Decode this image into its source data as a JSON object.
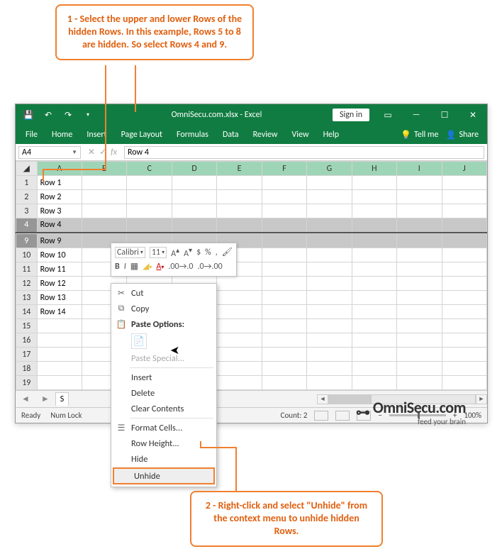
{
  "callouts": {
    "top": "1 - Select the upper and lower Rows of the hidden Rows. In this example, Rows 5 to 8 are hidden. So select Rows 4 and 9.",
    "bottom": "2 - Right-click and select \"Unhide\" from the context menu to unhide hidden Rows."
  },
  "titlebar": {
    "title": "OmniSecu.com.xlsx - Excel",
    "signin": "Sign in"
  },
  "ribbon": {
    "tabs": [
      "File",
      "Home",
      "Insert",
      "Page Layout",
      "Formulas",
      "Data",
      "Review",
      "View",
      "Help"
    ],
    "tellme": "Tell me",
    "share": "Share"
  },
  "namebox": "A4",
  "formula_value": "Row 4",
  "columns": [
    "A",
    "B",
    "C",
    "D",
    "E",
    "F",
    "G",
    "H",
    "I",
    "J"
  ],
  "rows": [
    {
      "num": "1",
      "val": "Row 1",
      "sel": false
    },
    {
      "num": "2",
      "val": "Row 2",
      "sel": false
    },
    {
      "num": "3",
      "val": "Row 3",
      "sel": false
    },
    {
      "num": "4",
      "val": "Row 4",
      "sel": true
    },
    {
      "num": "9",
      "val": "Row 9",
      "sel": true,
      "aftergap": true
    },
    {
      "num": "10",
      "val": "Row 10",
      "sel": false
    },
    {
      "num": "11",
      "val": "Row 11",
      "sel": false
    },
    {
      "num": "12",
      "val": "Row 12",
      "sel": false
    },
    {
      "num": "13",
      "val": "Row 13",
      "sel": false
    },
    {
      "num": "14",
      "val": "Row 14",
      "sel": false
    },
    {
      "num": "15",
      "val": "",
      "sel": false
    },
    {
      "num": "16",
      "val": "",
      "sel": false
    },
    {
      "num": "17",
      "val": "",
      "sel": false
    },
    {
      "num": "18",
      "val": "",
      "sel": false
    },
    {
      "num": "19",
      "val": "",
      "sel": false
    }
  ],
  "mini_toolbar": {
    "font": "Calibri",
    "size": "11"
  },
  "context_menu": {
    "cut": "Cut",
    "copy": "Copy",
    "paste_options": "Paste Options:",
    "paste_special": "Paste Special...",
    "insert": "Insert",
    "delete": "Delete",
    "clear": "Clear Contents",
    "format": "Format Cells...",
    "row_height": "Row Height...",
    "hide": "Hide",
    "unhide": "Unhide"
  },
  "sheet_tab": "S",
  "statusbar": {
    "ready": "Ready",
    "numlock": "Num Lock",
    "count": "Count: 2",
    "zoom": "100%"
  },
  "watermark": {
    "main": "OmniSecu.com",
    "sub": "feed your brain"
  }
}
